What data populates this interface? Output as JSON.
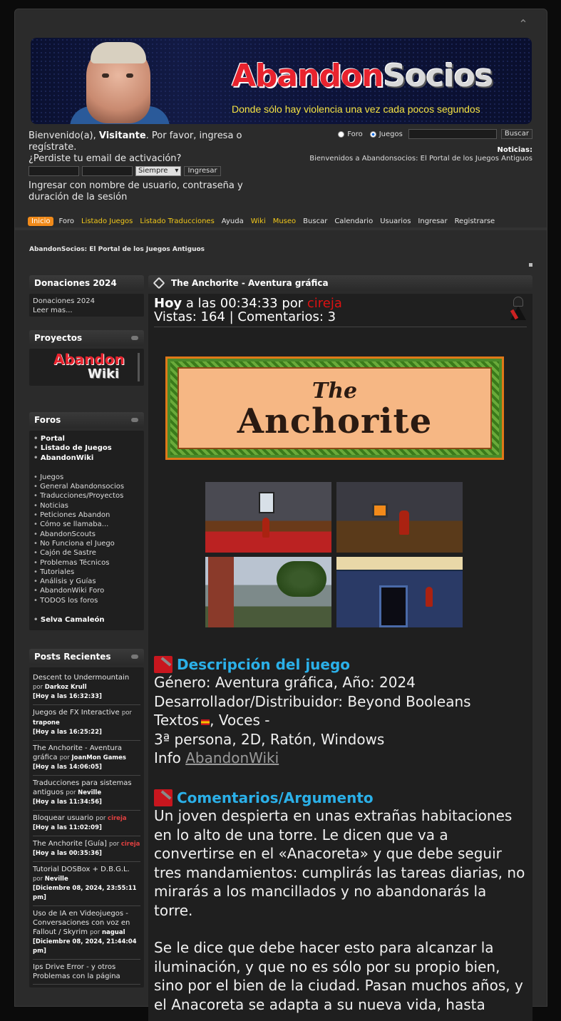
{
  "banner": {
    "logo_a": "Abandon",
    "logo_b": "Socios",
    "tagline": "Donde sólo hay violencia una vez cada pocos segundos"
  },
  "login": {
    "welcome_pre": "Bienvenido(a), ",
    "visitor": "Visitante",
    "welcome_post": ". Por favor, ingresa o regístrate.",
    "lost_email": "¿Perdiste tu email de activación?",
    "duration_option": "Siempre",
    "login_button": "Ingresar",
    "note": "Ingresar con nombre de usuario, contraseña y duración de la sesión"
  },
  "search": {
    "opt_foro": "Foro",
    "opt_juegos": "Juegos",
    "selected": "Juegos",
    "button": "Buscar"
  },
  "news": {
    "label": "Noticias:",
    "text": "Bienvenidos a Abandonsocios: El Portal de los Juegos Antiguos"
  },
  "menu": [
    {
      "label": "Inicio",
      "style": "active"
    },
    {
      "label": "Foro",
      "style": "plain"
    },
    {
      "label": "Listado Juegos",
      "style": "yellow"
    },
    {
      "label": "Listado Traducciones",
      "style": "yellow"
    },
    {
      "label": "Ayuda",
      "style": "plain"
    },
    {
      "label": "Wiki",
      "style": "yellow"
    },
    {
      "label": "Museo",
      "style": "yellow"
    },
    {
      "label": "Buscar",
      "style": "plain"
    },
    {
      "label": "Calendario",
      "style": "plain"
    },
    {
      "label": "Usuarios",
      "style": "plain"
    },
    {
      "label": "Ingresar",
      "style": "plain"
    },
    {
      "label": "Registrarse",
      "style": "plain"
    }
  ],
  "breadcrumb": "AbandonSocios: El Portal de los Juegos Antiguos",
  "sidebar": {
    "donations": {
      "title": "Donaciones 2024",
      "img_alt": "Donaciones 2024",
      "more": "Leer mas..."
    },
    "projects": {
      "title": "Proyectos",
      "logo_a": "Abandon",
      "logo_b": "Wiki"
    },
    "forums": {
      "title": "Foros",
      "top": [
        "Portal",
        "Listado de Juegos",
        "AbandonWiki"
      ],
      "items": [
        "Juegos",
        "General Abandonsocios",
        "Traducciones/Proyectos",
        "Noticias",
        "Peticiones Abandon",
        "Cómo se llamaba...",
        "AbandonScouts",
        "No Funciona el Juego",
        "Cajón de Sastre",
        "Problemas Técnicos",
        "Tutoriales",
        "Análisis y Guías",
        "AbandonWiki Foro",
        "TODOS los foros"
      ],
      "bottom": "Selva Camaleón"
    },
    "recent": {
      "title": "Posts Recientes",
      "by_word": "por",
      "posts": [
        {
          "title": "Descent to Undermountain",
          "author": "Darkoz Krull",
          "date": "Hoy a las 16:32:33",
          "red": false
        },
        {
          "title": "Juegos de FX Interactive",
          "author": "trapone",
          "date": "Hoy a las 16:25:22",
          "red": false
        },
        {
          "title": "The Anchorite - Aventura gráfica",
          "author": "JoanMon Games",
          "date": "Hoy a las 14:06:05",
          "red": false
        },
        {
          "title": "Traducciones para sistemas antiguos",
          "author": "Neville",
          "date": "Hoy a las 11:34:56",
          "red": false
        },
        {
          "title": "Bloquear usuario",
          "author": "cireja",
          "date": "Hoy a las 11:02:09",
          "red": true
        },
        {
          "title": "The Anchorite [Guía]",
          "author": "cireja",
          "date": "Hoy a las 00:35:36",
          "red": true
        },
        {
          "title": "Tutorial DOSBox + D.B.G.L.",
          "author": "Neville",
          "date": "Diciembre 08, 2024, 23:55:11 pm",
          "red": false
        },
        {
          "title": "Uso de IA en Videojuegos - Conversaciones con voz en Fallout / Skyrim",
          "author": "nagual",
          "date": "Diciembre 08, 2024, 21:44:04 pm",
          "red": false
        },
        {
          "title": "Ips Drive Error - y otros Problemas con la página",
          "author": "",
          "date": "",
          "red": false
        }
      ]
    }
  },
  "article": {
    "header": "The Anchorite - Aventura gráfica",
    "day": "Hoy",
    "time": " a las 00:34:33 por ",
    "author": "cireja",
    "stats": "Vistas: 164 | Comentarios: 3",
    "title_img_the": "The",
    "title_img_anc": "Anchorite",
    "desc_title": "Descripción del juego",
    "genre": "Género: Aventura gráfica, Año: 2024",
    "developer": "Desarrollador/Distribuidor: Beyond Booleans",
    "texts": "Textos",
    "voices": ", Voces -",
    "specs": "3ª persona, 2D, Ratón, Windows",
    "info": "Info ",
    "info_link": "AbandonWiki",
    "arg_title": "Comentarios/Argumento",
    "para1": "Un joven despierta en unas extrañas habitaciones en lo alto de una torre. Le dicen que va a convertirse en el «Anacoreta» y que debe seguir tres mandamientos: cumplirás las tareas diarias, no mirarás a los mancillados y no abandonarás la torre.",
    "para2": "Se le dice que debe hacer esto para alcanzar la iluminación, y que no es sólo por su propio bien, sino por el bien de la ciudad. Pasan muchos años, y el Anacoreta se adapta a su nueva vida, hasta"
  },
  "colors": {
    "accent": "#f08a1a",
    "link_yellow": "#f2c81a",
    "heading_blue": "#2bb0e8",
    "author_red": "#d11111"
  }
}
